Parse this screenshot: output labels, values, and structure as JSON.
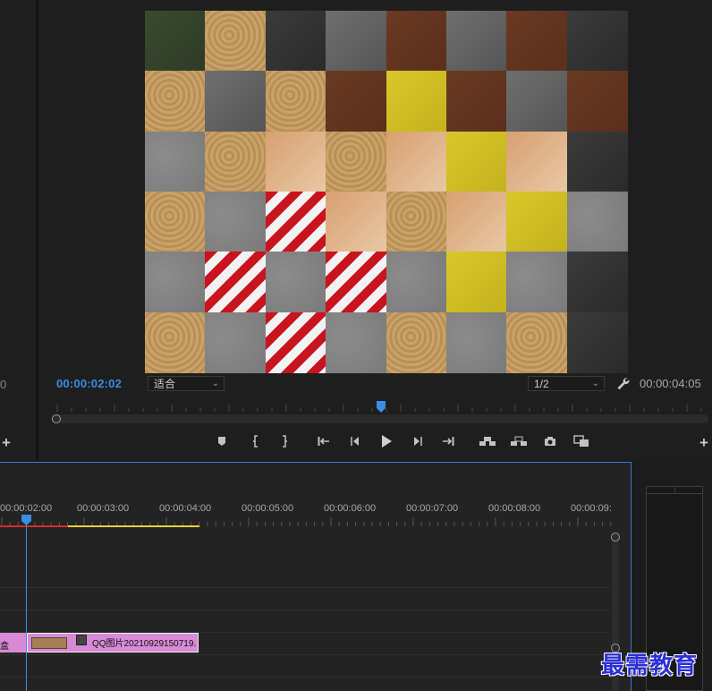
{
  "left_panel": {
    "timecode": "0"
  },
  "program_monitor": {
    "current_timecode": "00:00:02:02",
    "zoom_fit": "适合",
    "resolution": "1/2",
    "duration_timecode": "00:00:04:05"
  },
  "timeline": {
    "ruler_times": [
      "00:00:02:00",
      "00:00:03:00",
      "00:00:04:00",
      "00:00:05:00",
      "00:00:06:00",
      "00:00:07:00",
      "00:00:08:00",
      "00:00:09:"
    ],
    "clip_a_label": "盒",
    "clip_b_label": "QQ图片20210929150719."
  },
  "watermark": "最需教育",
  "colors": {
    "accent": "#3a8ee6",
    "clip": "#d88ad6",
    "render_red": "#d42b2b",
    "render_yellow": "#e5d23a"
  },
  "icons": [
    "marker-icon",
    "mark-in-icon",
    "mark-out-icon",
    "go-to-in-icon",
    "step-back-icon",
    "play-icon",
    "step-forward-icon",
    "go-to-out-icon",
    "lift-icon",
    "extract-icon",
    "export-frame-icon",
    "compare-icon",
    "wrench-icon",
    "add-icon"
  ]
}
